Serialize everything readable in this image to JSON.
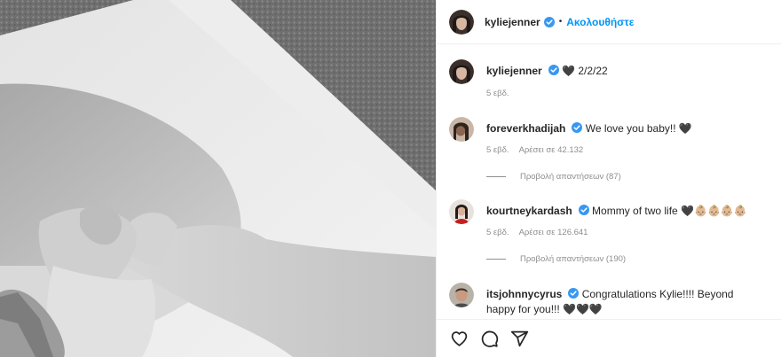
{
  "header": {
    "username": "kyliejenner",
    "separator": "•",
    "follow_label": "Ακολουθήστε"
  },
  "caption": {
    "username": "kyliejenner",
    "text": "🖤 2/2/22",
    "age": "5 εβδ."
  },
  "comments": [
    {
      "username": "foreverkhadijah",
      "text": "We love you baby!! 🖤",
      "age": "5 εβδ.",
      "likes": "Αρέσει σε 42.132",
      "replies": "Προβολή απαντήσεων (87)"
    },
    {
      "username": "kourtneykardash",
      "text": "Mommy of two life 🖤👶🏼👶🏼👶🏼👶🏼",
      "age": "5 εβδ.",
      "likes": "Αρέσει σε 126.641",
      "replies": "Προβολή απαντήσεων (190)"
    },
    {
      "username": "itsjohnnycyrus",
      "text": "Congratulations Kylie!!!! Beyond happy for you!!! 🖤🖤🖤"
    }
  ],
  "icons": {
    "like": "heart-icon",
    "comment": "comment-icon",
    "share": "share-icon",
    "verified": "verified-badge-icon"
  },
  "colors": {
    "accent": "#0095f6",
    "verified": "#3897f0",
    "muted": "#8e8e8e",
    "text": "#262626"
  }
}
